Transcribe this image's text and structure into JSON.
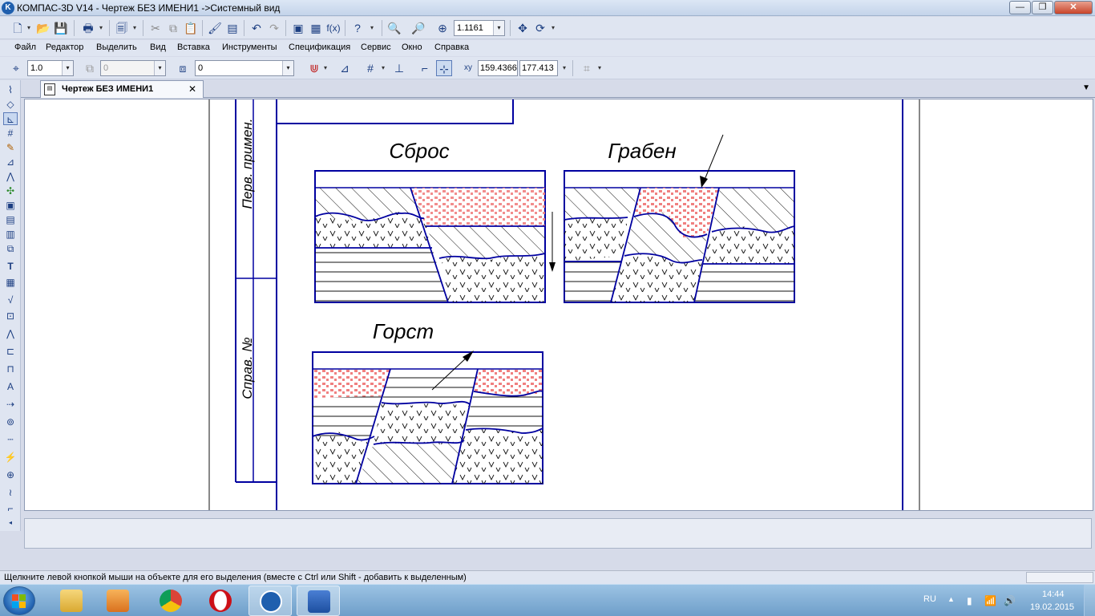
{
  "window": {
    "title": "КОМПАС-3D V14 - Чертеж БЕЗ ИМЕНИ1 ->Системный вид",
    "app_icon": "kompas-logo-icon",
    "minimize_label": "—",
    "restore_label": "❐",
    "close_label": "✕"
  },
  "toolbar_main": {
    "zoom_value": "1.1161"
  },
  "menu": {
    "items": [
      "Файл",
      "Редактор",
      "Выделить",
      "Вид",
      "Вставка",
      "Инструменты",
      "Спецификация",
      "Сервис",
      "Окно",
      "Справка"
    ]
  },
  "toolbar_current": {
    "step_value": "1.0",
    "layer_value": "0",
    "style_value": "0",
    "x_coord": "159.4366",
    "y_coord": "177.413"
  },
  "document_tab": {
    "label": "Чертеж БЕЗ ИМЕНИ1",
    "close_label": "✕"
  },
  "drawing": {
    "side_label_top": "Перв. примен.",
    "side_label_bottom": "Справ. №",
    "fault_titles": [
      "Сброс",
      "Грабен",
      "Горст"
    ],
    "colors": {
      "line": "#0000a0",
      "hatch": "#111111",
      "pink_rock": "#f08080"
    }
  },
  "status": {
    "hint": "Щелкните левой кнопкой мыши на объекте для его выделения (вместе с Ctrl или Shift - добавить к выделенным)"
  },
  "taskbar": {
    "apps": [
      "explorer-icon",
      "media-player-icon",
      "chrome-icon",
      "opera-icon",
      "kompas-icon",
      "word-icon"
    ],
    "lang": "RU",
    "time": "14:44",
    "date": "19.02.2015"
  }
}
